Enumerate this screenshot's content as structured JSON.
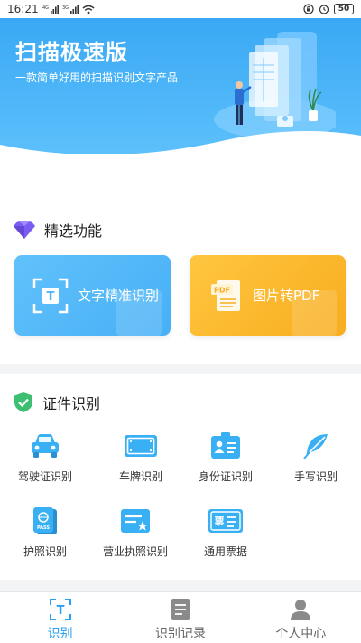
{
  "status_bar": {
    "time": "16:21",
    "signal_1": "4G",
    "signal_2": "3G",
    "battery": "50"
  },
  "banner": {
    "title": "扫描极速版",
    "subtitle": "一款简单好用的扫描识别文字产品"
  },
  "featured": {
    "title": "精选功能",
    "cards": [
      {
        "label": "文字精准识别",
        "icon": "text-scan-icon",
        "color": "#4fb6f7"
      },
      {
        "label": "图片转PDF",
        "icon": "pdf-icon",
        "color": "#fbb72c"
      }
    ]
  },
  "certificates": {
    "title": "证件识别",
    "items": [
      {
        "label": "驾驶证识别",
        "icon": "car-icon"
      },
      {
        "label": "车牌识别",
        "icon": "license-plate-icon"
      },
      {
        "label": "身份证识别",
        "icon": "id-card-icon"
      },
      {
        "label": "手写识别",
        "icon": "feather-icon"
      },
      {
        "label": "护照识别",
        "icon": "passport-icon"
      },
      {
        "label": "营业执照识别",
        "icon": "business-license-icon"
      },
      {
        "label": "通用票据",
        "icon": "receipt-icon"
      }
    ]
  },
  "bottom_nav": {
    "items": [
      {
        "label": "识别",
        "icon": "ocr-tab-icon",
        "active": true
      },
      {
        "label": "识别记录",
        "icon": "document-icon",
        "active": false
      },
      {
        "label": "个人中心",
        "icon": "person-icon",
        "active": false
      }
    ]
  },
  "colors": {
    "primary": "#2aa0f2",
    "banner_top": "#3aa8f4",
    "orange": "#fbb72c",
    "icon_blue": "#3ab0f4"
  }
}
